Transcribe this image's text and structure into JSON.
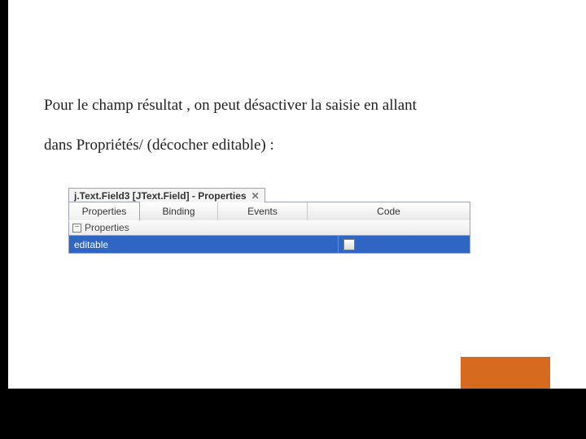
{
  "bodyText": {
    "line1": "Pour le champ résultat , on peut désactiver la saisie en allant",
    "line2": "dans Propriétés/ (décocher editable) :"
  },
  "panel": {
    "title": "j.Text.Field3 [JText.Field] - Properties",
    "tabs": {
      "properties": "Properties",
      "binding": "Binding",
      "events": "Events",
      "code": "Code"
    },
    "section": {
      "collapse_glyph": "−",
      "label": "Properties"
    },
    "row": {
      "name": "editable"
    }
  }
}
